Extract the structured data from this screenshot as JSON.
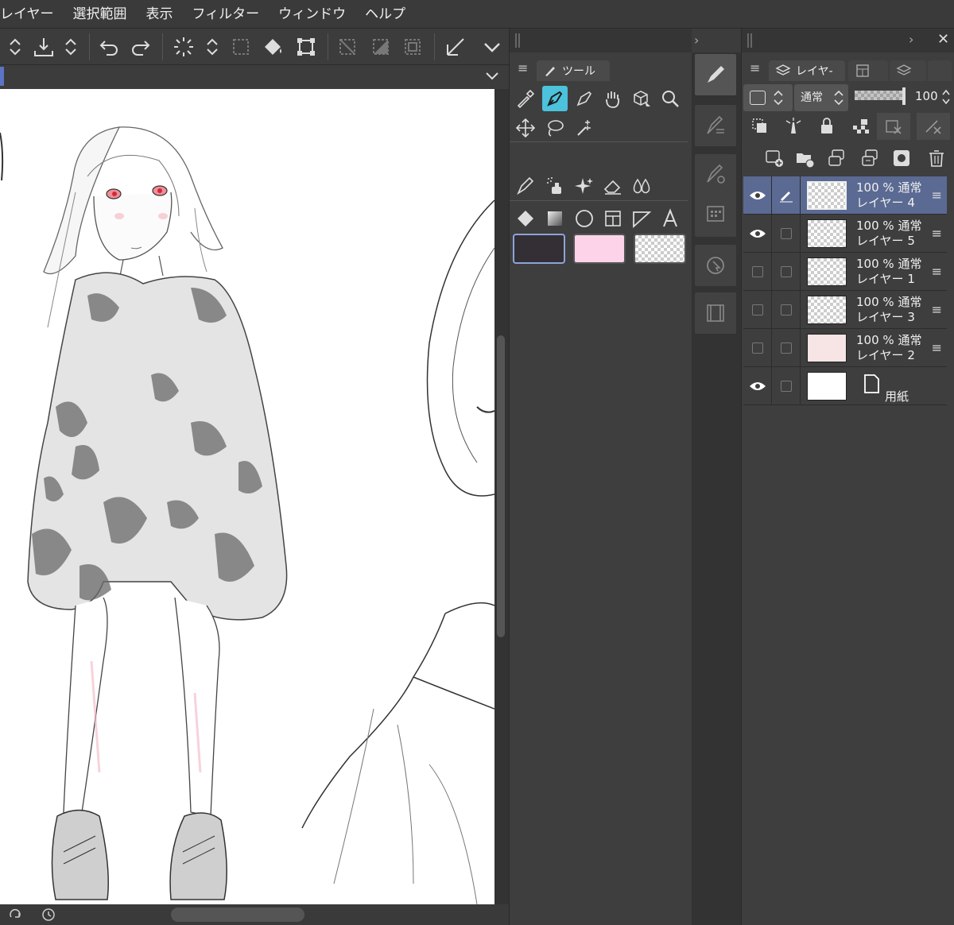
{
  "menubar": {
    "items": [
      "レイヤー",
      "選択範囲",
      "表示",
      "フィルター",
      "ウィンドウ",
      "ヘルプ"
    ]
  },
  "tool_panel": {
    "tab_label": "ツール",
    "active_tool": "pen",
    "colors": {
      "main": "#332f35",
      "sub": "#fdd3ea",
      "transparent": "transparent"
    }
  },
  "layer_panel": {
    "tab_label": "レイヤ-",
    "blend_mode": "通常",
    "opacity_value": "100",
    "layers": [
      {
        "opacity": "100 %",
        "mode": "通常",
        "name": "レイヤー 4",
        "visible": true,
        "selected": true,
        "editing": true
      },
      {
        "opacity": "100 %",
        "mode": "通常",
        "name": "レイヤー 5",
        "visible": true,
        "selected": false,
        "editing": false
      },
      {
        "opacity": "100 %",
        "mode": "通常",
        "name": "レイヤー 1",
        "visible": false,
        "selected": false,
        "editing": false
      },
      {
        "opacity": "100 %",
        "mode": "通常",
        "name": "レイヤー 3",
        "visible": false,
        "selected": false,
        "editing": false
      },
      {
        "opacity": "100 %",
        "mode": "通常",
        "name": "レイヤー 2",
        "visible": false,
        "selected": false,
        "editing": false
      },
      {
        "opacity": "",
        "mode": "",
        "name": "用紙",
        "visible": true,
        "selected": false,
        "editing": false
      }
    ]
  },
  "theme": {
    "accent": "#4cc2dc",
    "selection": "#5b6a93",
    "panel_bg": "#3e3e3e"
  }
}
